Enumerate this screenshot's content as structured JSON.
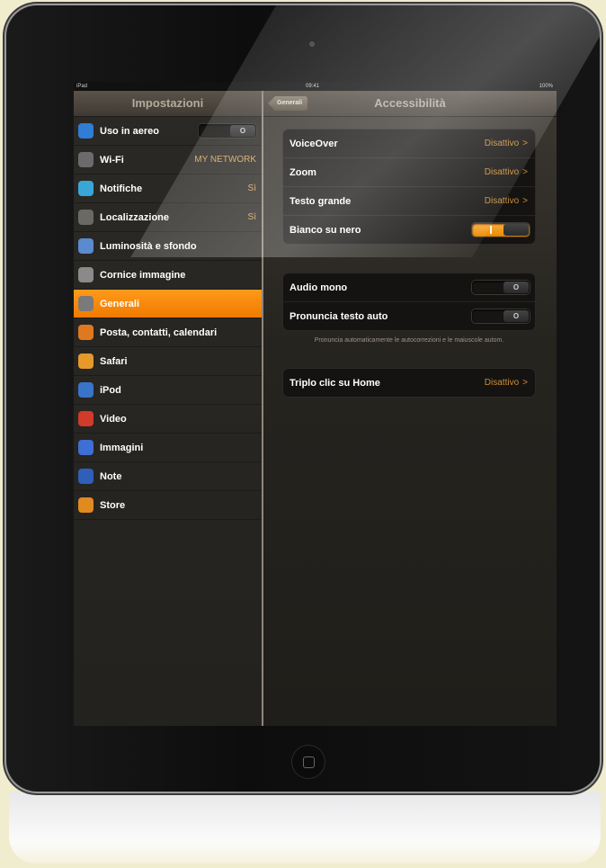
{
  "status": {
    "device": "iPad",
    "time": "09:41",
    "battery": "100%"
  },
  "master": {
    "title": "Impostazioni",
    "rows": [
      {
        "label": "Uso in aereo",
        "icon": "airplane-icon",
        "color": "#2f7dd4",
        "switch": "O"
      },
      {
        "label": "Wi-Fi",
        "icon": "wifi-icon",
        "color": "#6b6b6b",
        "value": "MY NETWORK"
      },
      {
        "label": "Notifiche",
        "icon": "notification-icon",
        "color": "#3aa6d8",
        "value": "Sì"
      },
      {
        "label": "Localizzazione",
        "icon": "location-icon",
        "color": "#6a6a62",
        "value": "Sì"
      },
      {
        "label": "Luminosità e sfondo",
        "icon": "brightness-icon",
        "color": "#5a8ad0"
      },
      {
        "label": "Cornice immagine",
        "icon": "picture-frame-icon",
        "color": "#8a8a8a"
      },
      {
        "label": "Generali",
        "icon": "gear-icon",
        "color": "#7a7a7a",
        "selected": true
      },
      {
        "label": "Posta, contatti, calendari",
        "icon": "mail-icon",
        "color": "#e07820"
      },
      {
        "label": "Safari",
        "icon": "compass-icon",
        "color": "#e59a2a"
      },
      {
        "label": "iPod",
        "icon": "ipod-icon",
        "color": "#3a74c8"
      },
      {
        "label": "Video",
        "icon": "video-icon",
        "color": "#d23a2a"
      },
      {
        "label": "Immagini",
        "icon": "photos-icon",
        "color": "#3d6fd4"
      },
      {
        "label": "Note",
        "icon": "notes-icon",
        "color": "#2f5fb8"
      },
      {
        "label": "Store",
        "icon": "store-icon",
        "color": "#e08a20"
      }
    ]
  },
  "detail": {
    "back_label": "Generali",
    "title": "Accessibilità",
    "group1": [
      {
        "label": "VoiceOver",
        "value": "Disattivo",
        "chevron": ">"
      },
      {
        "label": "Zoom",
        "value": "Disattivo",
        "chevron": ">"
      },
      {
        "label": "Testo grande",
        "value": "Disattivo",
        "chevron": ">"
      },
      {
        "label": "Bianco su nero",
        "switch_on": true
      }
    ],
    "group2": [
      {
        "label": "Audio mono",
        "switch": "O"
      },
      {
        "label": "Pronuncia testo auto",
        "switch": "O"
      }
    ],
    "footnote": "Pronuncia automaticamente le autocorrezioni e le maiuscole autom.",
    "group3": [
      {
        "label": "Triplo clic su Home",
        "value": "Disattivo",
        "chevron": ">"
      }
    ]
  }
}
